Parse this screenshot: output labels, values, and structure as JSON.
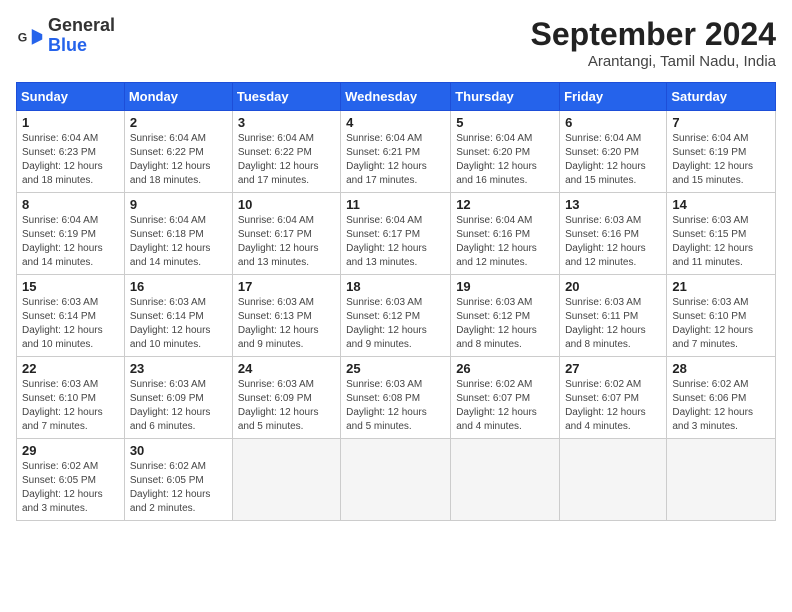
{
  "header": {
    "logo_general": "General",
    "logo_blue": "Blue",
    "month_year": "September 2024",
    "location": "Arantangi, Tamil Nadu, India"
  },
  "weekdays": [
    "Sunday",
    "Monday",
    "Tuesday",
    "Wednesday",
    "Thursday",
    "Friday",
    "Saturday"
  ],
  "weeks": [
    [
      {
        "day": "1",
        "info": "Sunrise: 6:04 AM\nSunset: 6:23 PM\nDaylight: 12 hours\nand 18 minutes."
      },
      {
        "day": "2",
        "info": "Sunrise: 6:04 AM\nSunset: 6:22 PM\nDaylight: 12 hours\nand 18 minutes."
      },
      {
        "day": "3",
        "info": "Sunrise: 6:04 AM\nSunset: 6:22 PM\nDaylight: 12 hours\nand 17 minutes."
      },
      {
        "day": "4",
        "info": "Sunrise: 6:04 AM\nSunset: 6:21 PM\nDaylight: 12 hours\nand 17 minutes."
      },
      {
        "day": "5",
        "info": "Sunrise: 6:04 AM\nSunset: 6:20 PM\nDaylight: 12 hours\nand 16 minutes."
      },
      {
        "day": "6",
        "info": "Sunrise: 6:04 AM\nSunset: 6:20 PM\nDaylight: 12 hours\nand 15 minutes."
      },
      {
        "day": "7",
        "info": "Sunrise: 6:04 AM\nSunset: 6:19 PM\nDaylight: 12 hours\nand 15 minutes."
      }
    ],
    [
      {
        "day": "8",
        "info": "Sunrise: 6:04 AM\nSunset: 6:19 PM\nDaylight: 12 hours\nand 14 minutes."
      },
      {
        "day": "9",
        "info": "Sunrise: 6:04 AM\nSunset: 6:18 PM\nDaylight: 12 hours\nand 14 minutes."
      },
      {
        "day": "10",
        "info": "Sunrise: 6:04 AM\nSunset: 6:17 PM\nDaylight: 12 hours\nand 13 minutes."
      },
      {
        "day": "11",
        "info": "Sunrise: 6:04 AM\nSunset: 6:17 PM\nDaylight: 12 hours\nand 13 minutes."
      },
      {
        "day": "12",
        "info": "Sunrise: 6:04 AM\nSunset: 6:16 PM\nDaylight: 12 hours\nand 12 minutes."
      },
      {
        "day": "13",
        "info": "Sunrise: 6:03 AM\nSunset: 6:16 PM\nDaylight: 12 hours\nand 12 minutes."
      },
      {
        "day": "14",
        "info": "Sunrise: 6:03 AM\nSunset: 6:15 PM\nDaylight: 12 hours\nand 11 minutes."
      }
    ],
    [
      {
        "day": "15",
        "info": "Sunrise: 6:03 AM\nSunset: 6:14 PM\nDaylight: 12 hours\nand 10 minutes."
      },
      {
        "day": "16",
        "info": "Sunrise: 6:03 AM\nSunset: 6:14 PM\nDaylight: 12 hours\nand 10 minutes."
      },
      {
        "day": "17",
        "info": "Sunrise: 6:03 AM\nSunset: 6:13 PM\nDaylight: 12 hours\nand 9 minutes."
      },
      {
        "day": "18",
        "info": "Sunrise: 6:03 AM\nSunset: 6:12 PM\nDaylight: 12 hours\nand 9 minutes."
      },
      {
        "day": "19",
        "info": "Sunrise: 6:03 AM\nSunset: 6:12 PM\nDaylight: 12 hours\nand 8 minutes."
      },
      {
        "day": "20",
        "info": "Sunrise: 6:03 AM\nSunset: 6:11 PM\nDaylight: 12 hours\nand 8 minutes."
      },
      {
        "day": "21",
        "info": "Sunrise: 6:03 AM\nSunset: 6:10 PM\nDaylight: 12 hours\nand 7 minutes."
      }
    ],
    [
      {
        "day": "22",
        "info": "Sunrise: 6:03 AM\nSunset: 6:10 PM\nDaylight: 12 hours\nand 7 minutes."
      },
      {
        "day": "23",
        "info": "Sunrise: 6:03 AM\nSunset: 6:09 PM\nDaylight: 12 hours\nand 6 minutes."
      },
      {
        "day": "24",
        "info": "Sunrise: 6:03 AM\nSunset: 6:09 PM\nDaylight: 12 hours\nand 5 minutes."
      },
      {
        "day": "25",
        "info": "Sunrise: 6:03 AM\nSunset: 6:08 PM\nDaylight: 12 hours\nand 5 minutes."
      },
      {
        "day": "26",
        "info": "Sunrise: 6:02 AM\nSunset: 6:07 PM\nDaylight: 12 hours\nand 4 minutes."
      },
      {
        "day": "27",
        "info": "Sunrise: 6:02 AM\nSunset: 6:07 PM\nDaylight: 12 hours\nand 4 minutes."
      },
      {
        "day": "28",
        "info": "Sunrise: 6:02 AM\nSunset: 6:06 PM\nDaylight: 12 hours\nand 3 minutes."
      }
    ],
    [
      {
        "day": "29",
        "info": "Sunrise: 6:02 AM\nSunset: 6:05 PM\nDaylight: 12 hours\nand 3 minutes."
      },
      {
        "day": "30",
        "info": "Sunrise: 6:02 AM\nSunset: 6:05 PM\nDaylight: 12 hours\nand 2 minutes."
      },
      null,
      null,
      null,
      null,
      null
    ]
  ]
}
